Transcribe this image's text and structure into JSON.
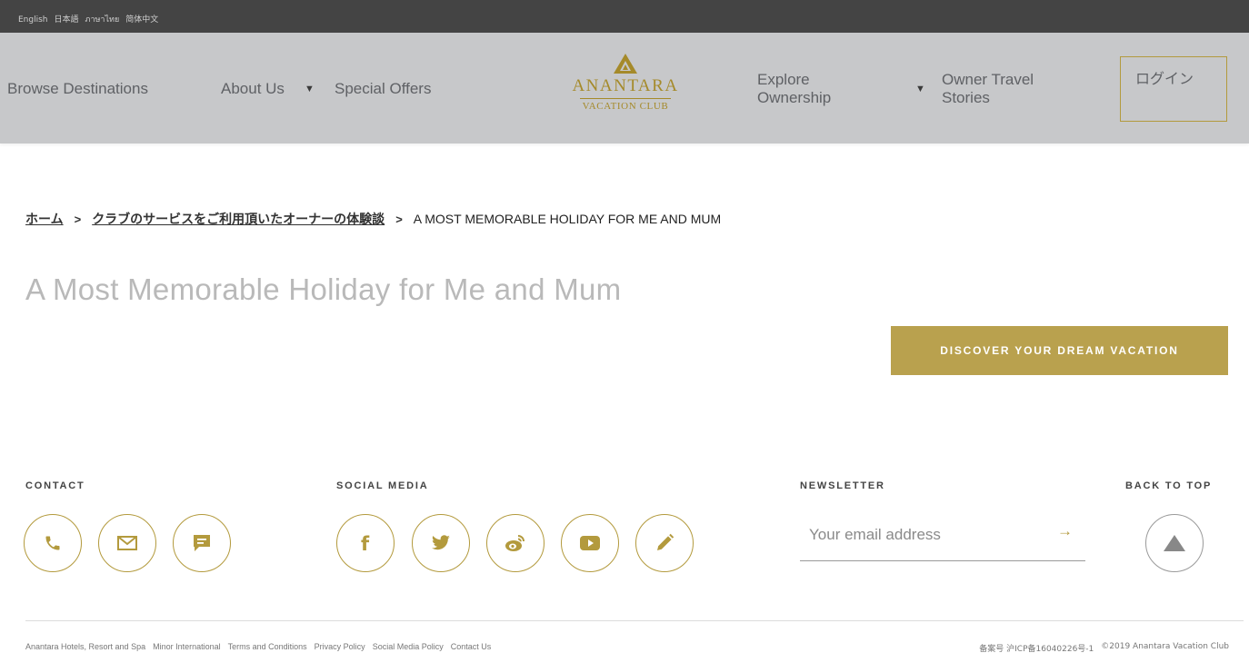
{
  "language_bar": {
    "languages": [
      "English",
      "日本語",
      "ภาษาไทย",
      "简体中文"
    ]
  },
  "nav": {
    "browse": "Browse Destinations",
    "about": "About Us",
    "offers": "Special Offers",
    "explore": "Explore Ownership",
    "stories": "Owner Travel Stories",
    "login": "ログイン",
    "logo_brand": "ANANTARA",
    "logo_sub": "VACATION CLUB"
  },
  "breadcrumb": {
    "home": "ホーム",
    "sep": ">",
    "section": "クラブのサービスをご利用頂いたオーナーの体験談",
    "current": "A MOST MEMORABLE HOLIDAY FOR ME AND MUM"
  },
  "page": {
    "title": "A Most Memorable Holiday for Me and Mum",
    "cta": "DISCOVER YOUR DREAM VACATION"
  },
  "footer": {
    "contact_heading": "CONTACT",
    "social_heading": "SOCIAL MEDIA",
    "newsletter_heading": "NEWSLETTER",
    "backtotop_heading": "BACK TO TOP",
    "newsletter_placeholder": "Your email address",
    "newsletter_arrow": "→",
    "links": [
      "Anantara Hotels, Resort and Spa",
      "Minor International",
      "Terms and Conditions",
      "Privacy Policy",
      "Social Media Policy",
      "Contact Us"
    ],
    "icp": "备案号 沪ICP备16040226号-1",
    "copyright": "©2019 Anantara Vacation Club"
  },
  "colors": {
    "gold": "#b39a3d",
    "cta_gold": "#b9a14e",
    "nav_bg": "#c7c8ca",
    "lang_bg": "#444444"
  },
  "icons": {
    "contact": [
      "phone-icon",
      "mail-icon",
      "chat-icon"
    ],
    "social": [
      "facebook-icon",
      "twitter-icon",
      "weibo-icon",
      "youtube-icon",
      "pencil-icon"
    ],
    "back_to_top": "triangle-up-icon"
  }
}
